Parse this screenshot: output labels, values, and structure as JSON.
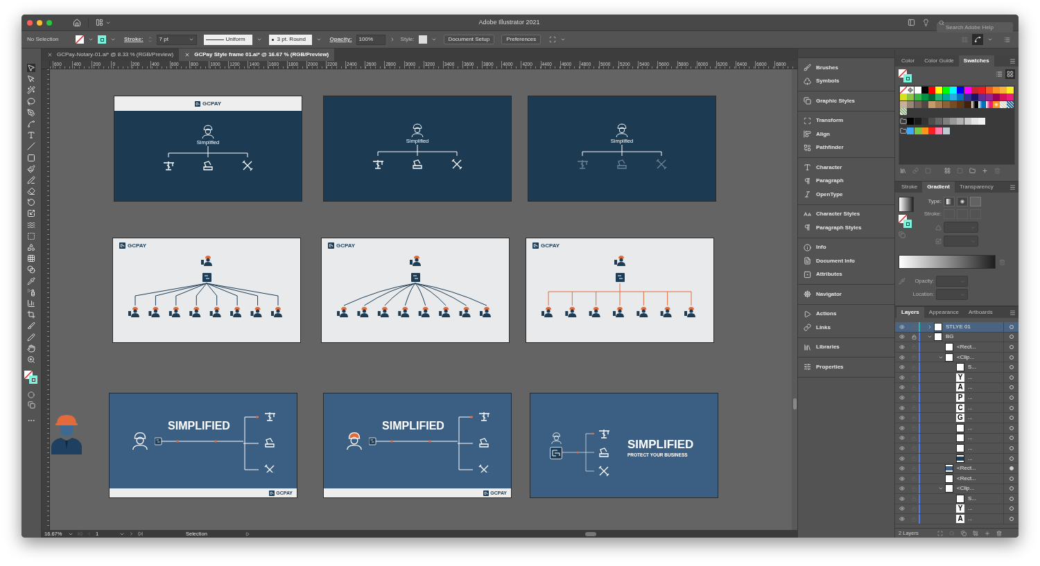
{
  "window": {
    "title": "Adobe Illustrator 2021",
    "search_placeholder": "Search Adobe Help"
  },
  "control_bar": {
    "selection": "No Selection",
    "stroke_label": "Stroke:",
    "stroke_weight": "7 pt",
    "profile": "Uniform",
    "brush": "3 pt. Round",
    "opacity_label": "Opacity:",
    "opacity": "100%",
    "style_label": "Style:",
    "buttons": [
      "Document Setup",
      "Preferences"
    ]
  },
  "document_tabs": [
    {
      "label": "GCPay-Notary-01.ai* @ 8.33 % (RGB/Preview)",
      "selected": false
    },
    {
      "label": "GCPay Style frame 01.ai* @ 16.67 % (RGB/Preview)",
      "selected": true
    }
  ],
  "ruler_labels": [
    "600",
    "400",
    "200",
    "0",
    "200",
    "400",
    "600",
    "800",
    "1000",
    "1200",
    "1400",
    "1600",
    "1800",
    "2000",
    "2200",
    "2400",
    "2600",
    "2800",
    "3000",
    "3200",
    "3400",
    "3600",
    "3800",
    "4000",
    "4200",
    "4400",
    "4600",
    "4800",
    "5000",
    "5200",
    "5400",
    "5600",
    "5800",
    "6000",
    "6200",
    "6400",
    "6600",
    "6800"
  ],
  "artboards": [
    {
      "kind": "header-dark",
      "logo": "GCPAY",
      "title": "Simplified",
      "icons_faded": false
    },
    {
      "kind": "dark",
      "title": "Simplified",
      "icons_faded": false
    },
    {
      "kind": "dark",
      "title": "Simplified",
      "icons_faded": true
    },
    {
      "kind": "org",
      "logo": "GCPAY",
      "curved": false,
      "accent": false,
      "team": [
        {
          "kind": "worker"
        },
        {
          "kind": "worker"
        },
        {
          "kind": "worker"
        },
        {
          "kind": "worker"
        },
        {
          "kind": "worker"
        },
        {
          "kind": "worker"
        },
        {
          "kind": "worker"
        },
        {
          "kind": "worker"
        }
      ]
    },
    {
      "kind": "org",
      "logo": "GCPAY",
      "curved": true,
      "accent": false,
      "team": [
        {
          "kind": "worker"
        },
        {
          "kind": "worker"
        },
        {
          "kind": "worker"
        },
        {
          "kind": "worker"
        },
        {
          "kind": "worker"
        },
        {
          "kind": "worker"
        },
        {
          "kind": "worker"
        },
        {
          "kind": "worker"
        }
      ]
    },
    {
      "kind": "org",
      "logo": "GCPAY",
      "curved": false,
      "accent": true,
      "team": [
        {
          "kind": "worker"
        },
        {
          "kind": "worker"
        },
        {
          "kind": "worker"
        },
        {
          "kind": "worker"
        },
        {
          "kind": "worker"
        },
        {
          "kind": "worker"
        },
        {
          "kind": "worker"
        }
      ]
    },
    {
      "kind": "banner",
      "title": "SIMPLIFIED",
      "orange_hat": false,
      "logo": "GCPAY"
    },
    {
      "kind": "banner",
      "title": "SIMPLIFIED",
      "orange_hat": true,
      "logo": "GCPAY"
    },
    {
      "kind": "banner-tagline",
      "title": "SIMPLIFIED",
      "tagline": "PROTECT YOUR BUSINESS"
    }
  ],
  "dock": [
    {
      "items": [
        "Brushes",
        "Symbols"
      ]
    },
    {
      "items": [
        "Graphic Styles"
      ]
    },
    {
      "items": [
        "Transform",
        "Align",
        "Pathfinder"
      ]
    },
    {
      "items": [
        "Character",
        "Paragraph",
        "OpenType"
      ]
    },
    {
      "items": [
        "Character Styles",
        "Paragraph Styles"
      ]
    },
    {
      "items": [
        "Info",
        "Document Info",
        "Attributes"
      ]
    },
    {
      "items": [
        "Navigator"
      ]
    },
    {
      "items": [
        "Actions",
        "Links"
      ]
    },
    {
      "items": [
        "Libraries"
      ]
    },
    {
      "items": [
        "Properties"
      ]
    }
  ],
  "swatches_panel": {
    "tabs": [
      {
        "label": "Color",
        "selected": false
      },
      {
        "label": "Color Guide",
        "selected": false
      },
      {
        "label": "Swatches",
        "selected": true
      }
    ],
    "view_buttons": [
      {
        "kind": "list",
        "selected": false
      },
      {
        "kind": "grid",
        "selected": true
      }
    ],
    "swatches": [
      {
        "kind": "none"
      },
      {
        "kind": "registration"
      },
      {
        "kind": "solid",
        "color": "#ffffff"
      },
      {
        "kind": "solid",
        "color": "#000000"
      },
      {
        "kind": "solid",
        "color": "#ff0000"
      },
      {
        "kind": "solid",
        "color": "#ffff00"
      },
      {
        "kind": "solid",
        "color": "#00ff00"
      },
      {
        "kind": "solid",
        "color": "#00ffff"
      },
      {
        "kind": "solid",
        "color": "#0000ff"
      },
      {
        "kind": "solid",
        "color": "#ff00ff"
      },
      {
        "kind": "solid",
        "color": "#c1272d"
      },
      {
        "kind": "solid",
        "color": "#ed1c24"
      },
      {
        "kind": "solid",
        "color": "#f15a24"
      },
      {
        "kind": "solid",
        "color": "#f7931e"
      },
      {
        "kind": "solid",
        "color": "#fbb03b"
      },
      {
        "kind": "solid",
        "color": "#fcee21"
      },
      {
        "kind": "solid",
        "color": "#d9e021"
      },
      {
        "kind": "solid",
        "color": "#8cc63f"
      },
      {
        "kind": "solid",
        "color": "#39b54a"
      },
      {
        "kind": "solid",
        "color": "#009245"
      },
      {
        "kind": "solid",
        "color": "#006837"
      },
      {
        "kind": "solid",
        "color": "#22b573"
      },
      {
        "kind": "solid",
        "color": "#00a99d"
      },
      {
        "kind": "solid",
        "color": "#29abe2"
      },
      {
        "kind": "solid",
        "color": "#0071bc"
      },
      {
        "kind": "solid",
        "color": "#2e3192"
      },
      {
        "kind": "solid",
        "color": "#1b1464"
      },
      {
        "kind": "solid",
        "color": "#662d91"
      },
      {
        "kind": "solid",
        "color": "#93278f"
      },
      {
        "kind": "solid",
        "color": "#9e005d"
      },
      {
        "kind": "solid",
        "color": "#d4145a"
      },
      {
        "kind": "solid",
        "color": "#ed1e79"
      },
      {
        "kind": "solid",
        "color": "#c7b299"
      },
      {
        "kind": "solid",
        "color": "#998675"
      },
      {
        "kind": "solid",
        "color": "#736357"
      },
      {
        "kind": "solid",
        "color": "#534741"
      },
      {
        "kind": "solid",
        "color": "#c69c6d"
      },
      {
        "kind": "solid",
        "color": "#a67c52"
      },
      {
        "kind": "solid",
        "color": "#8c6239"
      },
      {
        "kind": "solid",
        "color": "#754c24"
      },
      {
        "kind": "solid",
        "color": "#603813"
      },
      {
        "kind": "solid",
        "color": "#42210b"
      },
      {
        "kind": "gradient",
        "color": "#000000"
      },
      {
        "kind": "gradient",
        "color": "#0071bc"
      },
      {
        "kind": "gradient",
        "color": "#ed1e79"
      },
      {
        "kind": "radial",
        "color": "#f7931e"
      },
      {
        "kind": "pattern",
        "color": "#e0dcc0"
      },
      {
        "kind": "pattern",
        "color": "#1b75bc"
      },
      {
        "kind": "pattern",
        "color": "#8fbf7f"
      }
    ],
    "groups": [
      [
        {
          "kind": "solid",
          "color": "#000000"
        },
        {
          "kind": "solid",
          "color": "#1a1a1a"
        },
        {
          "kind": "solid",
          "color": "#333333"
        },
        {
          "kind": "solid",
          "color": "#4d4d4d"
        },
        {
          "kind": "solid",
          "color": "#666666"
        },
        {
          "kind": "solid",
          "color": "#808080"
        },
        {
          "kind": "solid",
          "color": "#999999"
        },
        {
          "kind": "solid",
          "color": "#b3b3b3"
        },
        {
          "kind": "solid",
          "color": "#cccccc"
        },
        {
          "kind": "solid",
          "color": "#e6e6e6"
        },
        {
          "kind": "solid",
          "color": "#f2f2f2"
        }
      ],
      [
        {
          "kind": "solid",
          "color": "#3fa9f5"
        },
        {
          "kind": "solid",
          "color": "#7ac943"
        },
        {
          "kind": "solid",
          "color": "#ff931e"
        },
        {
          "kind": "solid",
          "color": "#ff1d25"
        },
        {
          "kind": "solid",
          "color": "#ff7bac"
        },
        {
          "kind": "solid",
          "color": "#bdccd4"
        }
      ]
    ]
  },
  "gradient_panel": {
    "tabs": [
      {
        "label": "Stroke",
        "selected": false
      },
      {
        "label": "Gradient",
        "selected": true
      },
      {
        "label": "Transparency",
        "selected": false
      }
    ],
    "type_label": "Type:",
    "stroke_label": "Stroke:",
    "opacity_label": "Opacity:",
    "location_label": "Location:"
  },
  "layers_panel": {
    "tabs": [
      {
        "label": "Layers",
        "selected": true
      },
      {
        "label": "Appearance",
        "selected": false
      },
      {
        "label": "Artboards",
        "selected": false
      }
    ],
    "layers": [
      {
        "name": "STLYE 01",
        "selected": true,
        "locked": false,
        "targeted": false,
        "expanded": false
      },
      {
        "name": "BG",
        "selected": false,
        "locked": true,
        "targeted": false,
        "expanded": true,
        "children": [
          {
            "name": "<Rect...",
            "selected": false,
            "locked": false,
            "targeted": false
          },
          {
            "name": "<Clip...",
            "selected": false,
            "locked": false,
            "targeted": false,
            "expanded": true,
            "children": [
              {
                "name": "S...",
                "selected": false,
                "locked": false,
                "targeted": false
              },
              {
                "name": "...",
                "thumb": "Y",
                "selected": false,
                "locked": false,
                "targeted": false
              },
              {
                "name": "...",
                "thumb": "A",
                "selected": false,
                "locked": false,
                "targeted": false
              },
              {
                "name": "...",
                "thumb": "P",
                "selected": false,
                "locked": false,
                "targeted": false
              },
              {
                "name": "...",
                "thumb": "C",
                "selected": false,
                "locked": false,
                "targeted": false
              },
              {
                "name": "...",
                "thumb": "G",
                "selected": false,
                "locked": false,
                "targeted": false
              },
              {
                "name": "...",
                "selected": false,
                "locked": false,
                "targeted": false
              },
              {
                "name": "...",
                "selected": false,
                "locked": false,
                "targeted": false
              },
              {
                "name": "...",
                "selected": false,
                "locked": false,
                "targeted": false
              },
              {
                "name": "...",
                "color": "#1d3d56",
                "selected": false,
                "locked": false,
                "targeted": false
              }
            ]
          },
          {
            "name": "<Rect...",
            "color": "#3b5f82",
            "selected": false,
            "locked": false,
            "targeted": true
          },
          {
            "name": "<Rect...",
            "selected": false,
            "locked": false,
            "targeted": false
          },
          {
            "name": "<Clip...",
            "selected": false,
            "locked": false,
            "targeted": false,
            "expanded": true,
            "children": [
              {
                "name": "S...",
                "selected": false,
                "locked": false,
                "targeted": false
              },
              {
                "name": "...",
                "thumb": "Y",
                "selected": false,
                "locked": false,
                "targeted": false
              },
              {
                "name": "...",
                "thumb": "A",
                "selected": false,
                "locked": false,
                "targeted": false
              }
            ]
          }
        ]
      }
    ],
    "footer": "2 Layers"
  },
  "status_bar": {
    "zoom": "16.67%",
    "artboard": "1",
    "tool": "Selection"
  }
}
